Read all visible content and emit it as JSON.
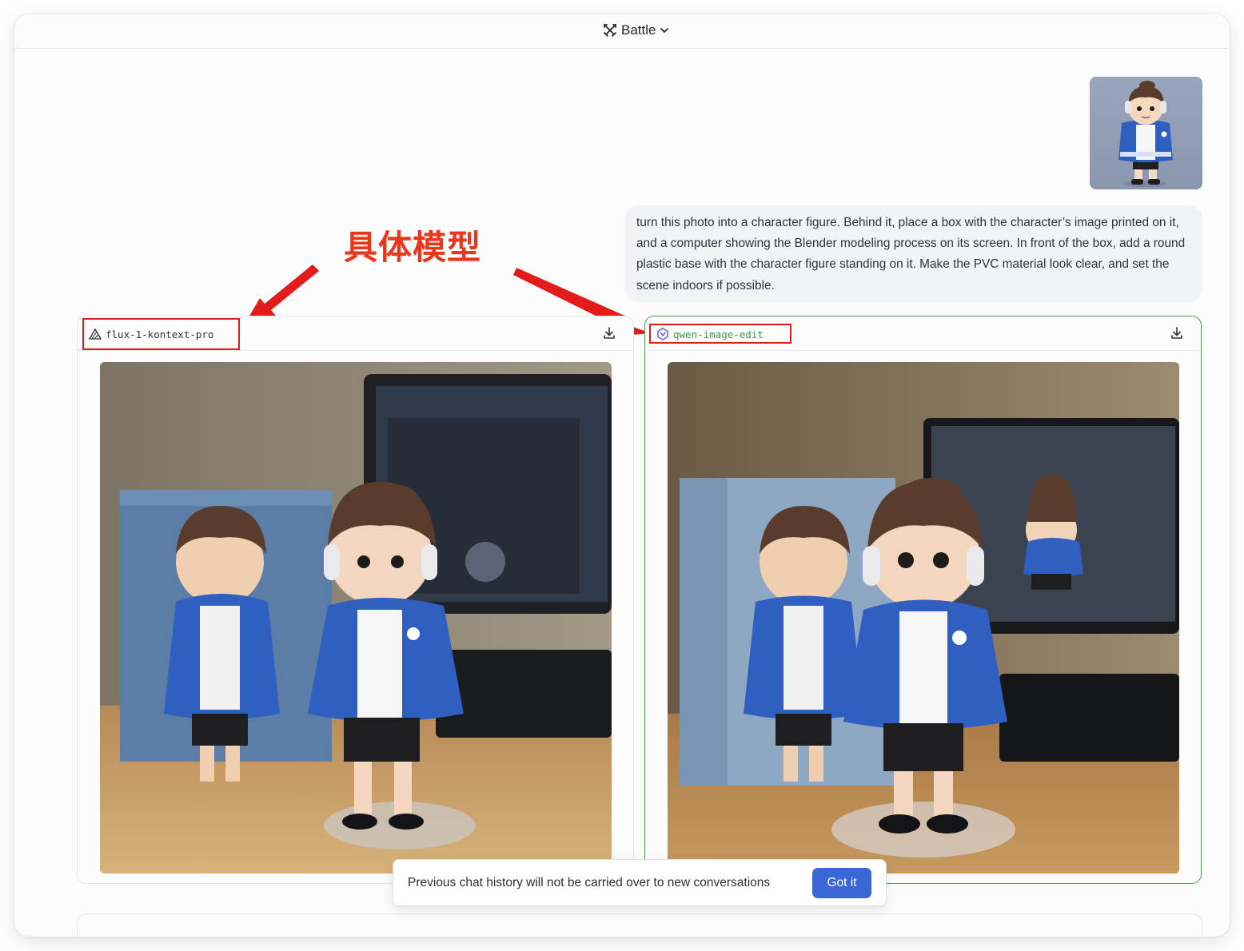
{
  "header": {
    "mode_label": "Battle"
  },
  "user_message": {
    "prompt": "turn this photo into a character figure. Behind it, place a box with the character’s image printed on it, and a computer showing the Blender modeling process on its screen. In front of the box, add a round plastic base with the character figure standing on it. Make the PVC material look clear, and set the scene indoors if possible."
  },
  "annotation": {
    "text": "具体模型",
    "color": "#e8371d"
  },
  "panels": [
    {
      "model": "flux-1-kontext-pro",
      "icon": "flux-triangle-icon",
      "selected": false
    },
    {
      "model": "qwen-image-edit",
      "icon": "qwen-logo-icon",
      "selected": true,
      "accent": "#4f9f58"
    }
  ],
  "toast": {
    "message": "Previous chat history will not be carried over to new conversations",
    "button": "Got it"
  },
  "colors": {
    "primary_button": "#3a66d6",
    "highlight_box": "#e21b1b"
  }
}
